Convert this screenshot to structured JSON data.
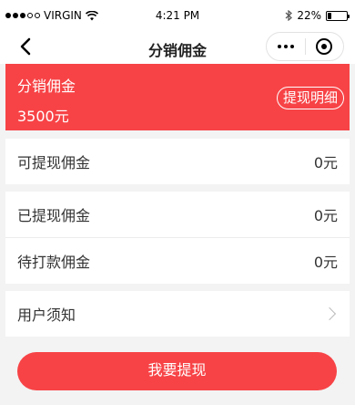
{
  "status_bar": {
    "carrier": "VIRGIN",
    "time": "4:21 PM",
    "battery": "22%",
    "battery_level": 0.22
  },
  "nav": {
    "title": "分销佣金"
  },
  "banner": {
    "title": "分销佣金",
    "amount": "3500元",
    "detail_label": "提现明细",
    "color": "#f74346"
  },
  "rows": {
    "withdrawable": {
      "label": "可提现佣金",
      "value": "0元"
    },
    "withdrawn": {
      "label": "已提现佣金",
      "value": "0元"
    },
    "pending": {
      "label": "待打款佣金",
      "value": "0元"
    },
    "notice": {
      "label": "用户须知"
    }
  },
  "actions": {
    "withdraw_label": "我要提现"
  }
}
